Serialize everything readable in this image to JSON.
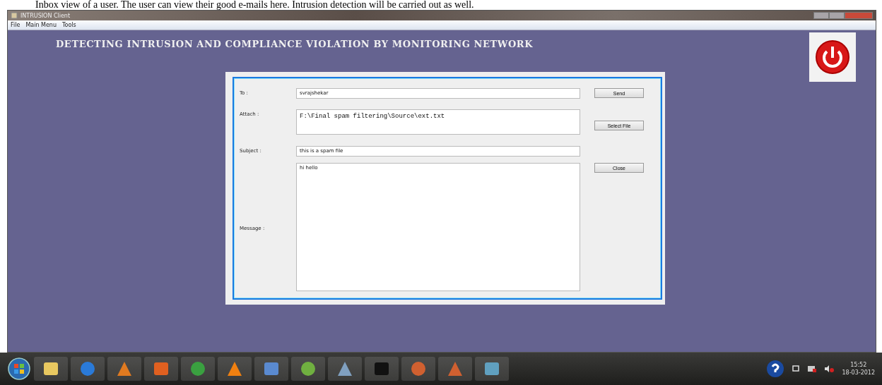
{
  "caption": "Inbox view of a user. The user can view their good e-mails here. Intrusion detection will be carried out as well.",
  "window": {
    "title": "INTRUSION Client"
  },
  "menu": [
    "File",
    "Main Menu",
    "Tools"
  ],
  "banner": "DETECTING INTRUSION AND COMPLIANCE VIOLATION BY MONITORING NETWORK",
  "form": {
    "fields": [
      {
        "label": "To :",
        "value": "svrajshekar",
        "kind": "line"
      },
      {
        "label": "Attach :",
        "value": "F:\\Final spam filtering\\Source\\ext.txt",
        "kind": "mono"
      },
      {
        "label": "Subject :",
        "value": "this is a spam file",
        "kind": "line"
      },
      {
        "label": "Message :",
        "value": "hi hello",
        "kind": "area"
      }
    ],
    "buttons": [
      "Send",
      "Select File",
      "Close"
    ]
  },
  "taskbar": {
    "clock": "15:52",
    "date": "18-03-2012"
  }
}
